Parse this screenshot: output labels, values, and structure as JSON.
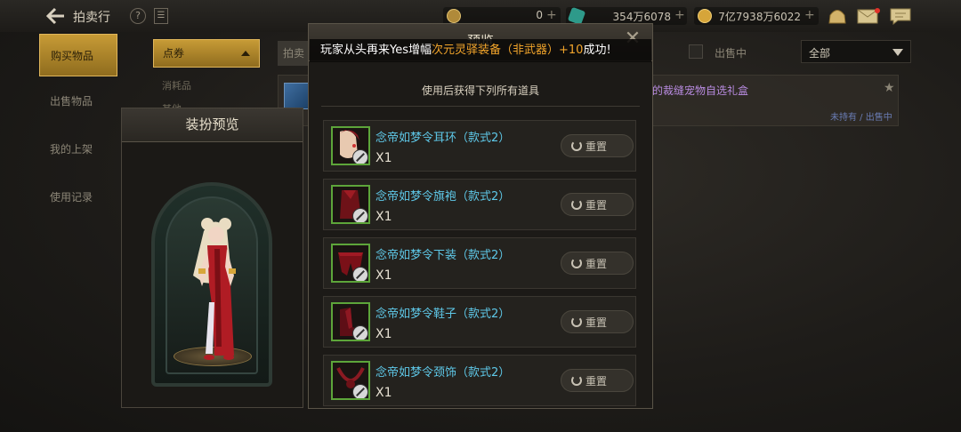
{
  "header": {
    "title": "拍卖行",
    "help_glyph": "?",
    "menu_glyph": "☰",
    "currency_1": "0",
    "currency_2": "354万6078",
    "currency_3": "7亿7938万6022",
    "plus": "+"
  },
  "sidebar": {
    "items": [
      {
        "label": "购买物品"
      },
      {
        "label": "出售物品"
      },
      {
        "label": "我的上架"
      },
      {
        "label": "使用记录"
      }
    ]
  },
  "filters": {
    "category": "点券",
    "sub_1": "消耗品",
    "sub_2": "其他",
    "hidden_tab": "拍卖",
    "onsale_label": "出售中",
    "select_value": "全部"
  },
  "listing": {
    "name": "的裁缝宠物自选礼盒",
    "status": "未持有 / 出售中",
    "star": "★"
  },
  "preview": {
    "title": "装扮预览"
  },
  "popup": {
    "title": "预览",
    "close": "✕",
    "subtitle": "使用后获得下列所有道具",
    "broadcast_pre": "玩家从头再来Yes增幅",
    "broadcast_item": "次元灵驿装备（非武器）+10",
    "broadcast_post": "成功!",
    "reset_label": "重置",
    "items": [
      {
        "name": "念帝如梦令耳环（款式2）",
        "qty": "X1"
      },
      {
        "name": "念帝如梦令旗袍（款式2）",
        "qty": "X1"
      },
      {
        "name": "念帝如梦令下装（款式2）",
        "qty": "X1"
      },
      {
        "name": "念帝如梦令鞋子（款式2）",
        "qty": "X1"
      },
      {
        "name": "念帝如梦令颈饰（款式2）",
        "qty": "X1"
      }
    ]
  }
}
